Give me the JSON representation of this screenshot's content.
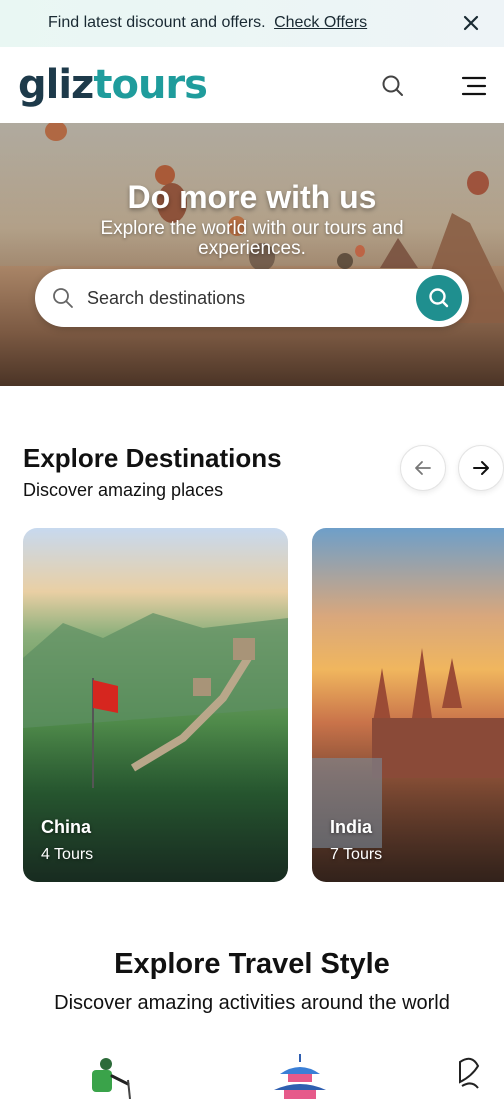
{
  "promo": {
    "text": "Find latest discount and offers.",
    "link": "Check Offers"
  },
  "header": {
    "logo_part1": "gliz",
    "logo_part2": "tours"
  },
  "hero": {
    "title": "Do more with us",
    "subtitle": "Explore the world with our tours and experiences.",
    "search_placeholder": "Search destinations"
  },
  "destinations": {
    "title": "Explore Destinations",
    "subtitle": "Discover amazing places",
    "cards": [
      {
        "name": "China",
        "count": "4 Tours"
      },
      {
        "name": "India",
        "count": "7 Tours"
      }
    ]
  },
  "travel_style": {
    "title": "Explore Travel Style",
    "subtitle": "Discover amazing activities around the world",
    "icons": [
      "hiker-icon",
      "pagoda-icon",
      "sailboat-icon"
    ]
  },
  "colors": {
    "accent": "#1f8f8f",
    "logo_dark": "#1d3a4a",
    "logo_teal": "#1f9c9c"
  }
}
